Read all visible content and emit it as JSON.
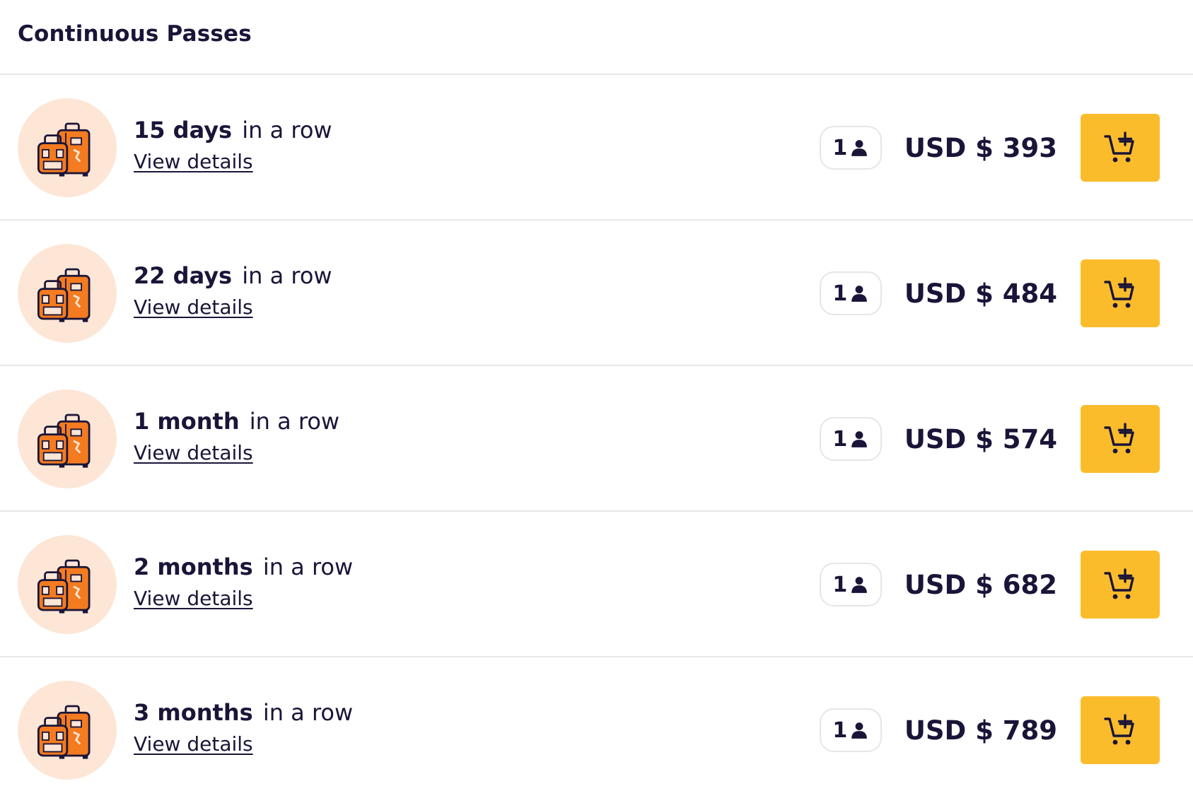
{
  "header": {
    "title": "Continuous Passes"
  },
  "passes": [
    {
      "duration": "15 days",
      "suffix": "in a row",
      "details_label": "View details",
      "travelers": "1",
      "price": "USD $ 393"
    },
    {
      "duration": "22 days",
      "suffix": "in a row",
      "details_label": "View details",
      "travelers": "1",
      "price": "USD $ 484"
    },
    {
      "duration": "1 month",
      "suffix": "in a row",
      "details_label": "View details",
      "travelers": "1",
      "price": "USD $ 574"
    },
    {
      "duration": "2 months",
      "suffix": "in a row",
      "details_label": "View details",
      "travelers": "1",
      "price": "USD $ 682"
    },
    {
      "duration": "3 months",
      "suffix": "in a row",
      "details_label": "View details",
      "travelers": "1",
      "price": "USD $ 789"
    }
  ],
  "icons": {
    "pass_image": "luggage-icon",
    "travelers": "person-icon",
    "add_to_cart": "add-to-cart-icon"
  },
  "colors": {
    "text": "#1a1538",
    "thumb_bg": "#fde6d6",
    "luggage_orange": "#f47b20",
    "cart_button": "#fbbc2c",
    "divider": "#e8e8ec"
  }
}
